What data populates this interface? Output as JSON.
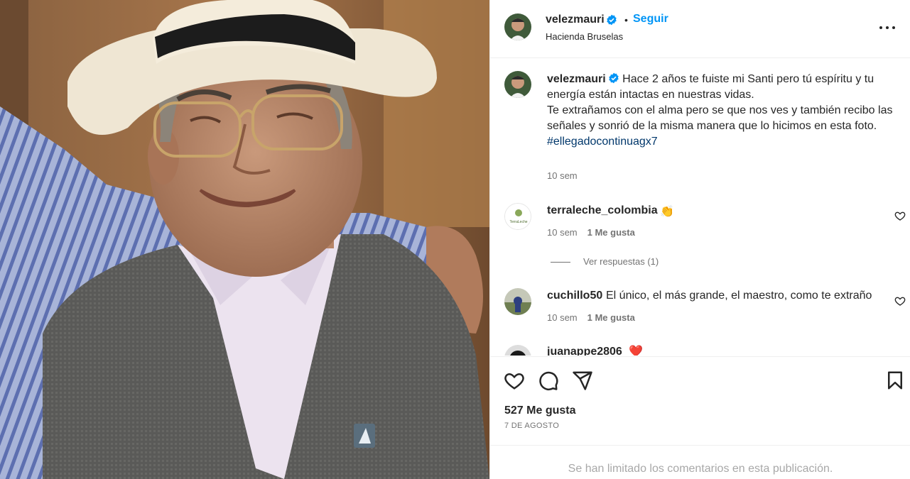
{
  "post": {
    "username": "velezmauri",
    "follow_label": "Seguir",
    "dot": "•",
    "location": "Hacienda Bruselas",
    "caption": {
      "line1": "Hace 2 años te fuiste mi Santi pero tú espíritu y tu energía están intactas en nuestras vidas.",
      "line2": "Te extrañamos con el alma pero se que nos ves y también recibo las señales y sonrió de la misma manera que lo hicimos en esta foto.",
      "hashtag": "#ellegadocontinuagx7",
      "time": "10 sem"
    },
    "likes": "527 Me gusta",
    "date": "7 DE AGOSTO",
    "comments_limited": "Se han limitado los comentarios en esta publicación."
  },
  "comments": [
    {
      "username": "terraleche_colombia",
      "text": "👏",
      "time": "10 sem",
      "likes": "1 Me gusta",
      "avatar_label": "TerraLeche"
    },
    {
      "username": "cuchillo50",
      "text": "El único, el más grande, el maestro, como te extraño",
      "time": "10 sem",
      "likes": "1 Me gusta"
    },
    {
      "username": "juanappe2806",
      "text": "❤️"
    }
  ],
  "replies_label": "Ver respuestas (1)",
  "colors": {
    "accent": "#0095f6",
    "verified": "#0095f6",
    "hashtag": "#00376b",
    "muted": "#737373",
    "heart_red": "#ed4956"
  },
  "icons": [
    "verified-badge-icon",
    "more-options-icon",
    "heart-icon",
    "comment-icon",
    "share-icon",
    "save-icon"
  ]
}
